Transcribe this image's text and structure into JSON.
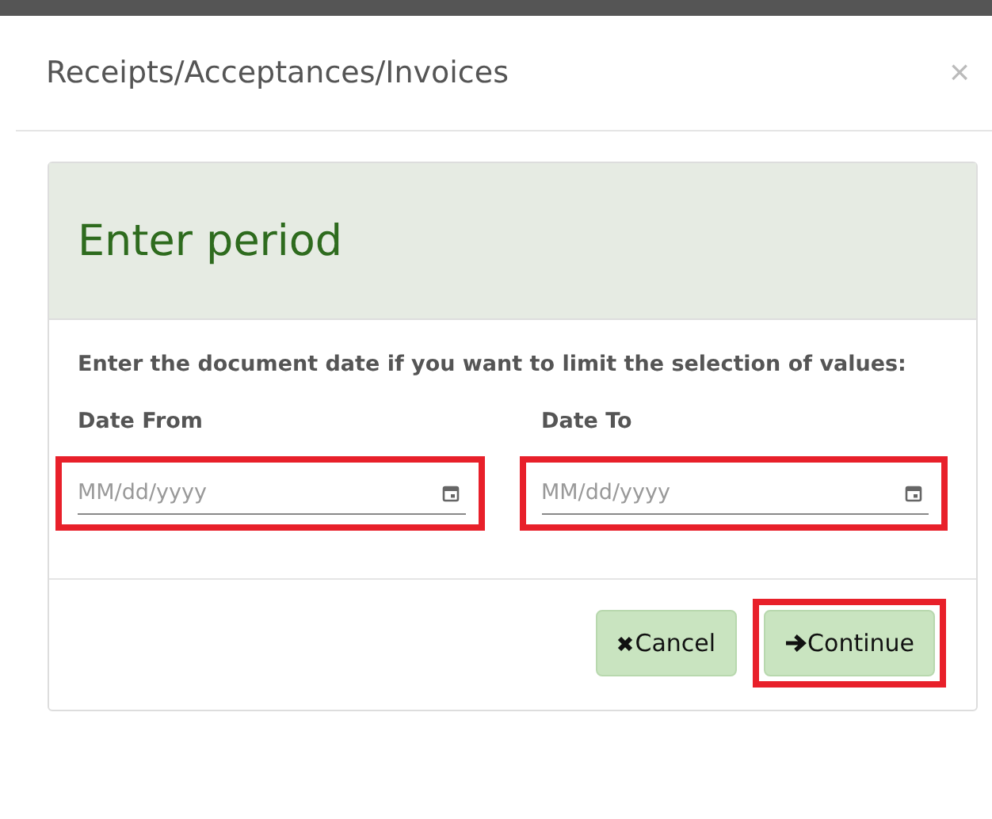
{
  "dialog": {
    "title": "Receipts/Acceptances/Invoices",
    "close": "×"
  },
  "panel": {
    "heading": "Enter period",
    "instruction": "Enter the document date if you want to limit the selection of values:",
    "fields": [
      {
        "label": "Date From",
        "placeholder": "MM/dd/yyyy",
        "highlighted": true
      },
      {
        "label": "Date To",
        "placeholder": "MM/dd/yyyy",
        "highlighted": true
      }
    ],
    "buttons": [
      {
        "kind": "cancel",
        "label": "Cancel",
        "highlighted": false
      },
      {
        "kind": "continue",
        "label": "Continue",
        "highlighted": true
      }
    ]
  }
}
